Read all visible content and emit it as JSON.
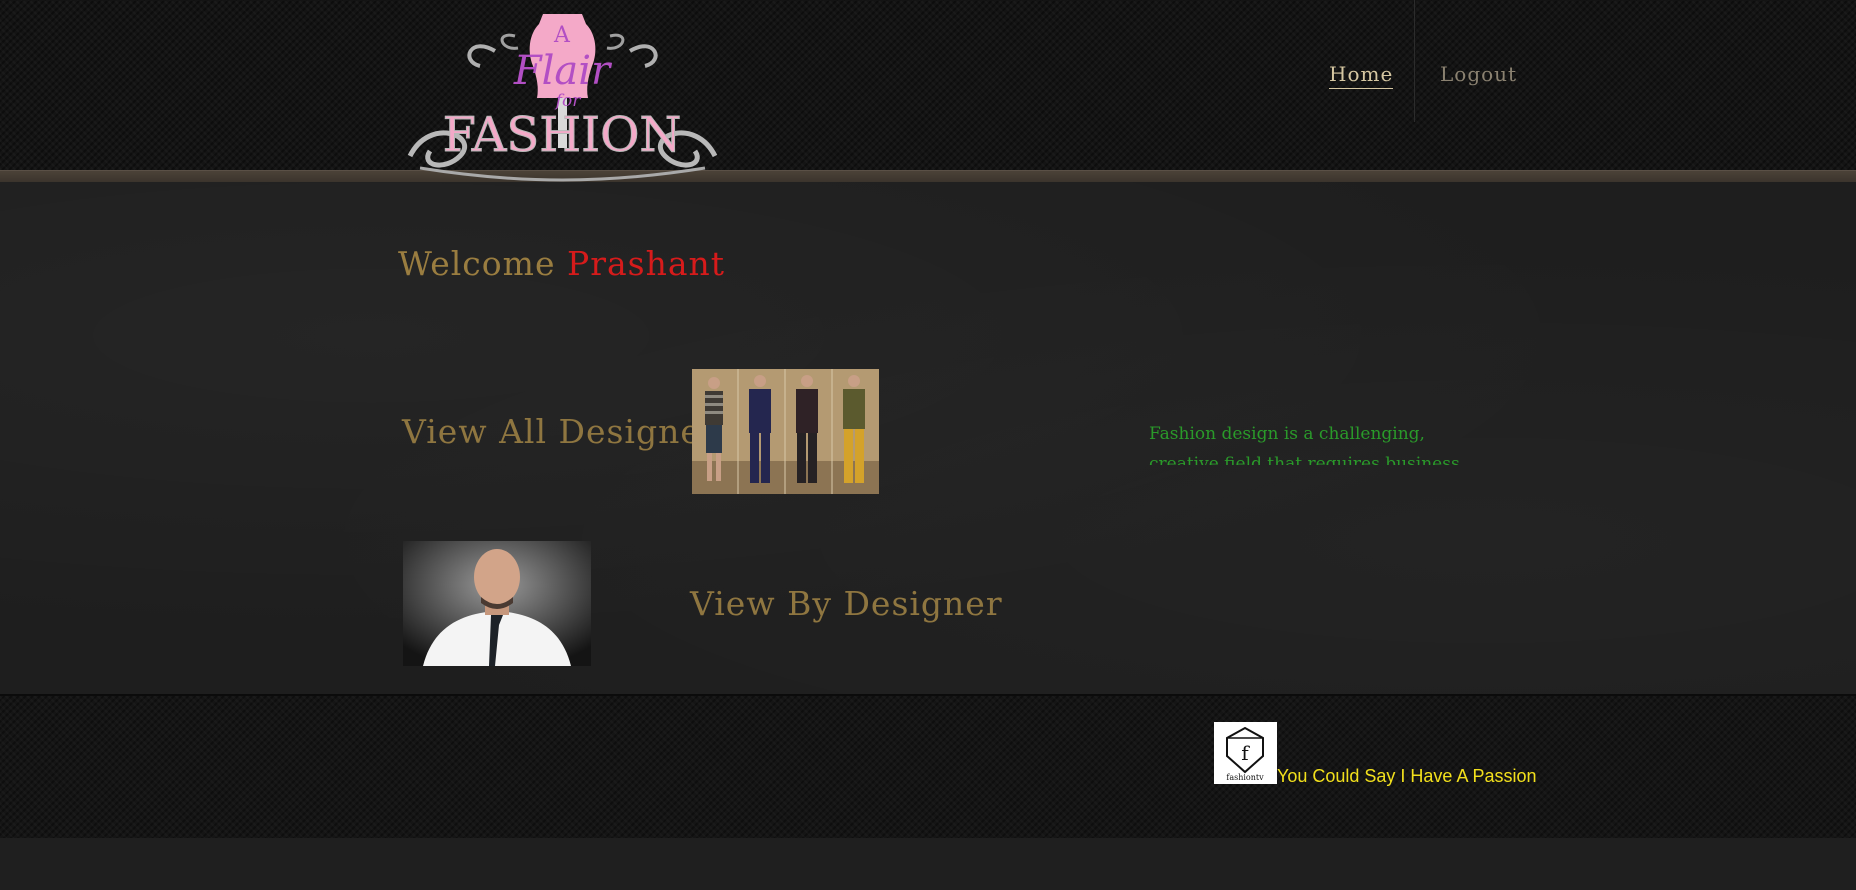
{
  "header": {
    "logo": {
      "line1": "A",
      "line2": "Flair",
      "line3": "for",
      "line4": "FASHION"
    },
    "nav": {
      "home": "Home",
      "logout": "Logout"
    }
  },
  "main": {
    "welcome": {
      "prefix": "Welcome",
      "username": "Prashant"
    },
    "view_all_label": "View All Designes",
    "view_by_label": "View By Designer",
    "info_text": "Fashion design is a challenging, creative field that requires business, art and design"
  },
  "footer": {
    "logo_text": "fashiontv",
    "tagline": "You Could Say I Have A Passion"
  },
  "colors": {
    "brand_gold": "#9a7d40",
    "username_red": "#d61b1b",
    "info_green": "#2a9a2a",
    "tagline_yellow": "#f2e01c",
    "logo_pink": "#f4a9c8",
    "logo_purple": "#b24fc4"
  }
}
